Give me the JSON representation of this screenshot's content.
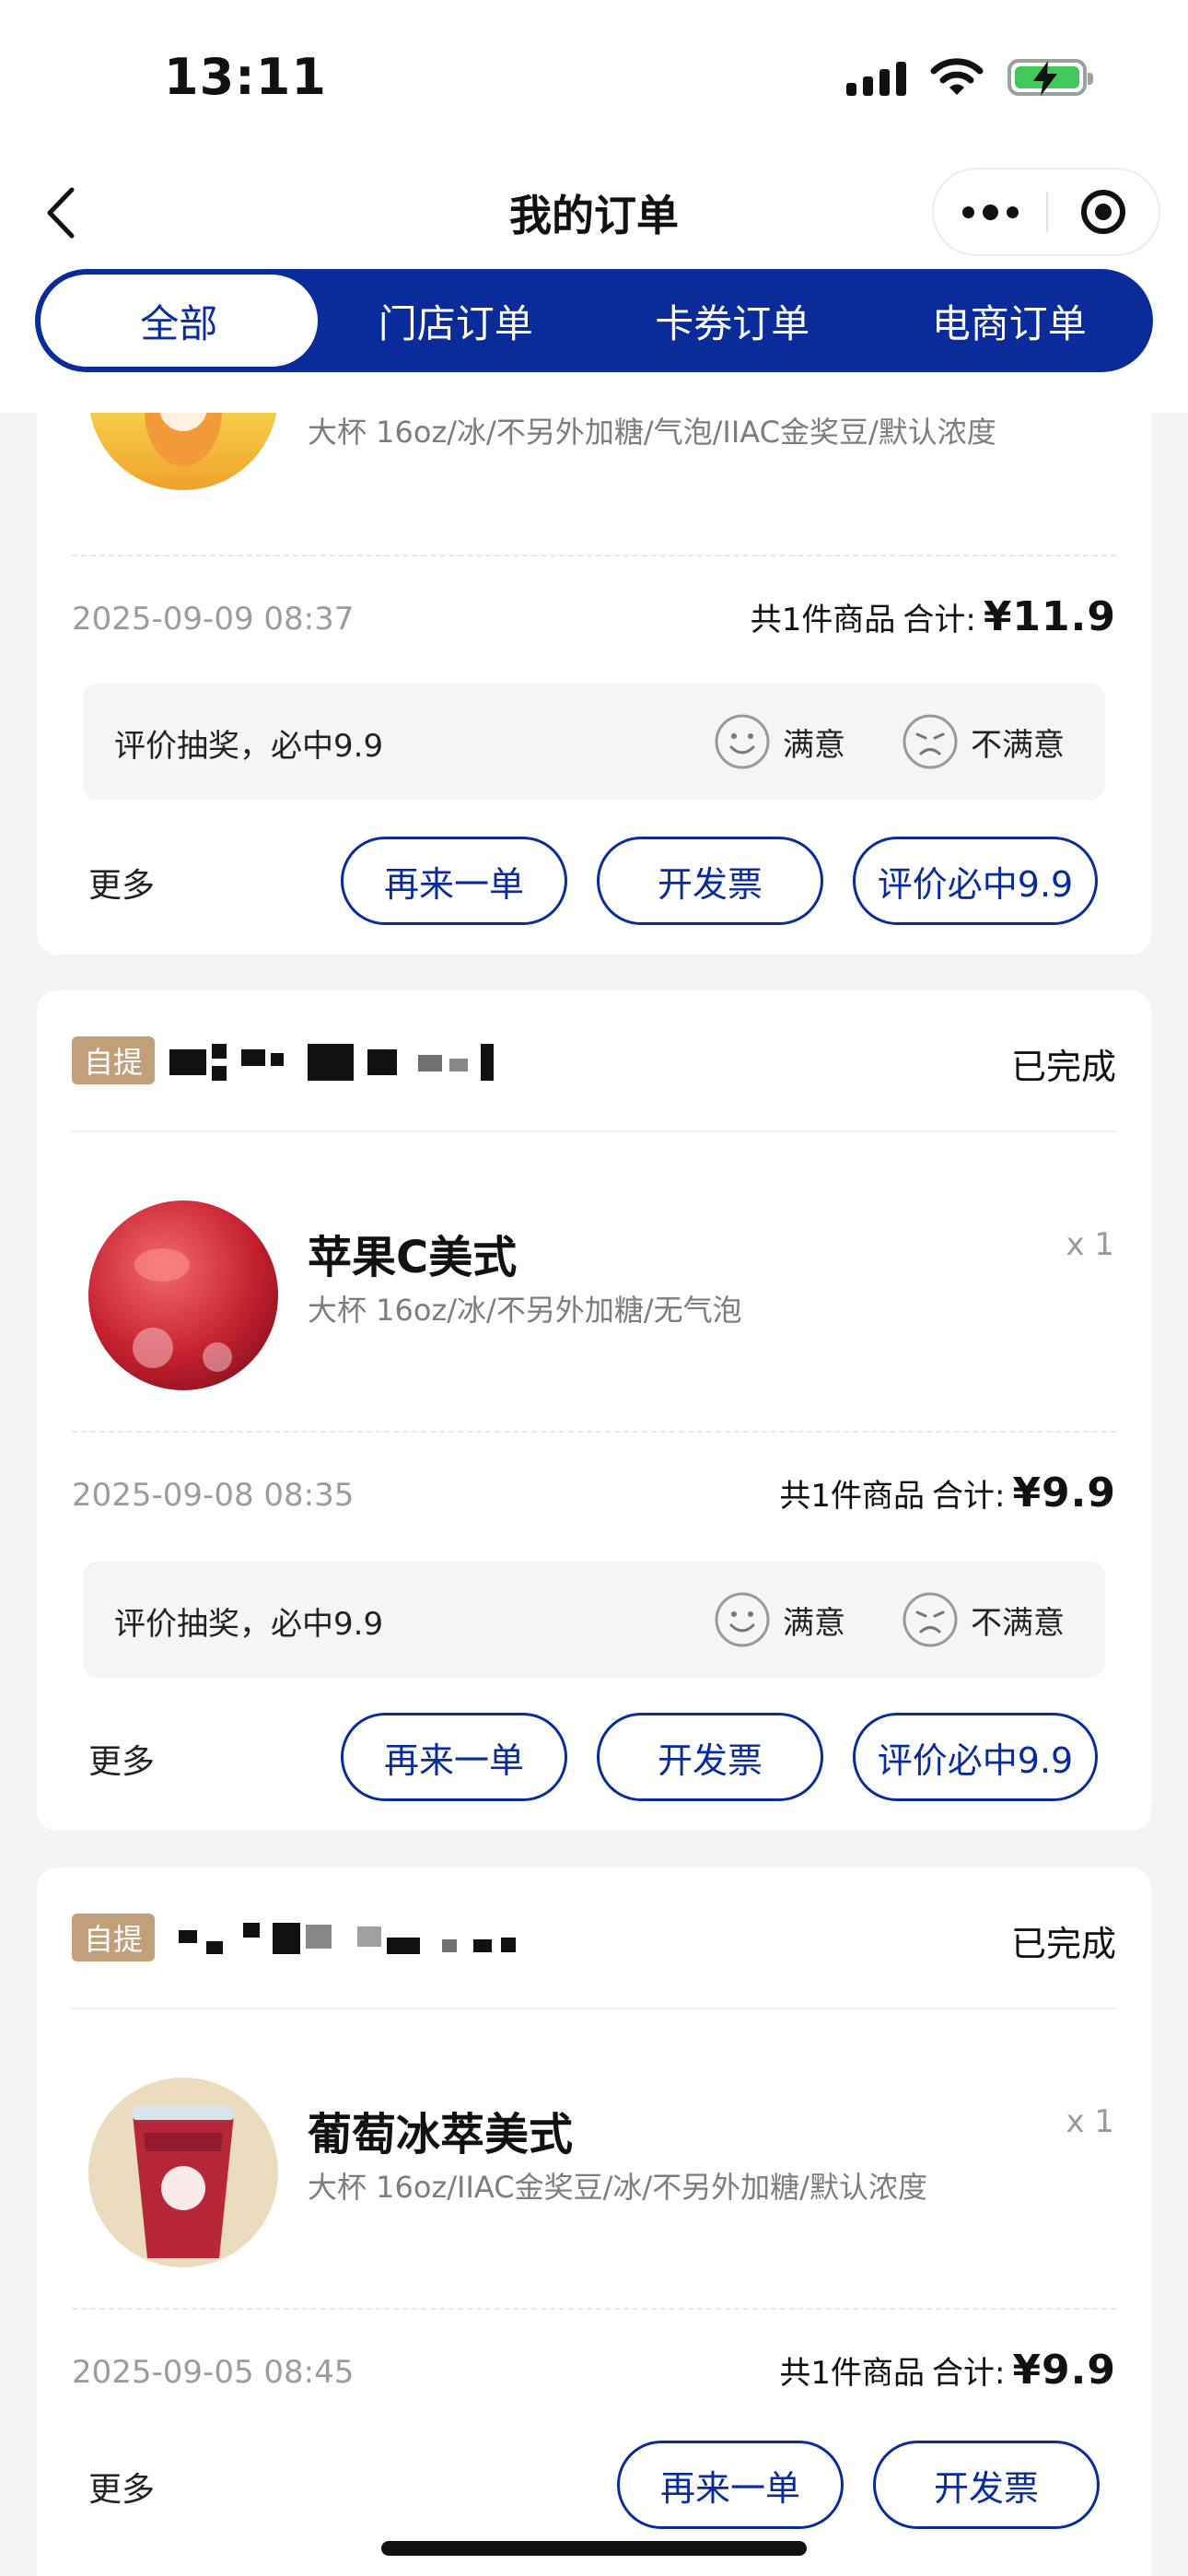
{
  "status_bar": {
    "time": "13:11"
  },
  "nav": {
    "title": "我的订单"
  },
  "tabs": [
    {
      "label": "全部",
      "active": true
    },
    {
      "label": "门店订单",
      "active": false
    },
    {
      "label": "卡券订单",
      "active": false
    },
    {
      "label": "电商订单",
      "active": false
    }
  ],
  "orders": [
    {
      "product_spec": "大杯 16oz/冰/不另外加糖/气泡/IIAC金奖豆/默认浓度",
      "date": "2025-09-09 08:37",
      "count_text": "共1件商品",
      "total_label": "合计:",
      "price": "¥11.9",
      "rate_prompt": "评价抽奖，必中9.9",
      "satisfied": "满意",
      "unsatisfied": "不满意",
      "more": "更多",
      "buttons": [
        "再来一单",
        "开发票",
        "评价必中9.9"
      ]
    },
    {
      "tag": "自提",
      "status": "已完成",
      "product_name": "苹果C美式",
      "product_spec": "大杯 16oz/冰/不另外加糖/无气泡",
      "qty": "x 1",
      "date": "2025-09-08 08:35",
      "count_text": "共1件商品",
      "total_label": "合计:",
      "price": "¥9.9",
      "rate_prompt": "评价抽奖，必中9.9",
      "satisfied": "满意",
      "unsatisfied": "不满意",
      "more": "更多",
      "buttons": [
        "再来一单",
        "开发票",
        "评价必中9.9"
      ]
    },
    {
      "tag": "自提",
      "status": "已完成",
      "product_name": "葡萄冰萃美式",
      "product_spec": "大杯 16oz/IIAC金奖豆/冰/不另外加糖/默认浓度",
      "qty": "x 1",
      "date": "2025-09-05 08:45",
      "count_text": "共1件商品",
      "total_label": "合计:",
      "price": "¥9.9",
      "more": "更多",
      "buttons": [
        "再来一单",
        "开发票"
      ]
    }
  ],
  "colors": {
    "brand_blue": "#0a2c9b",
    "tag_gold": "#c1a079"
  }
}
